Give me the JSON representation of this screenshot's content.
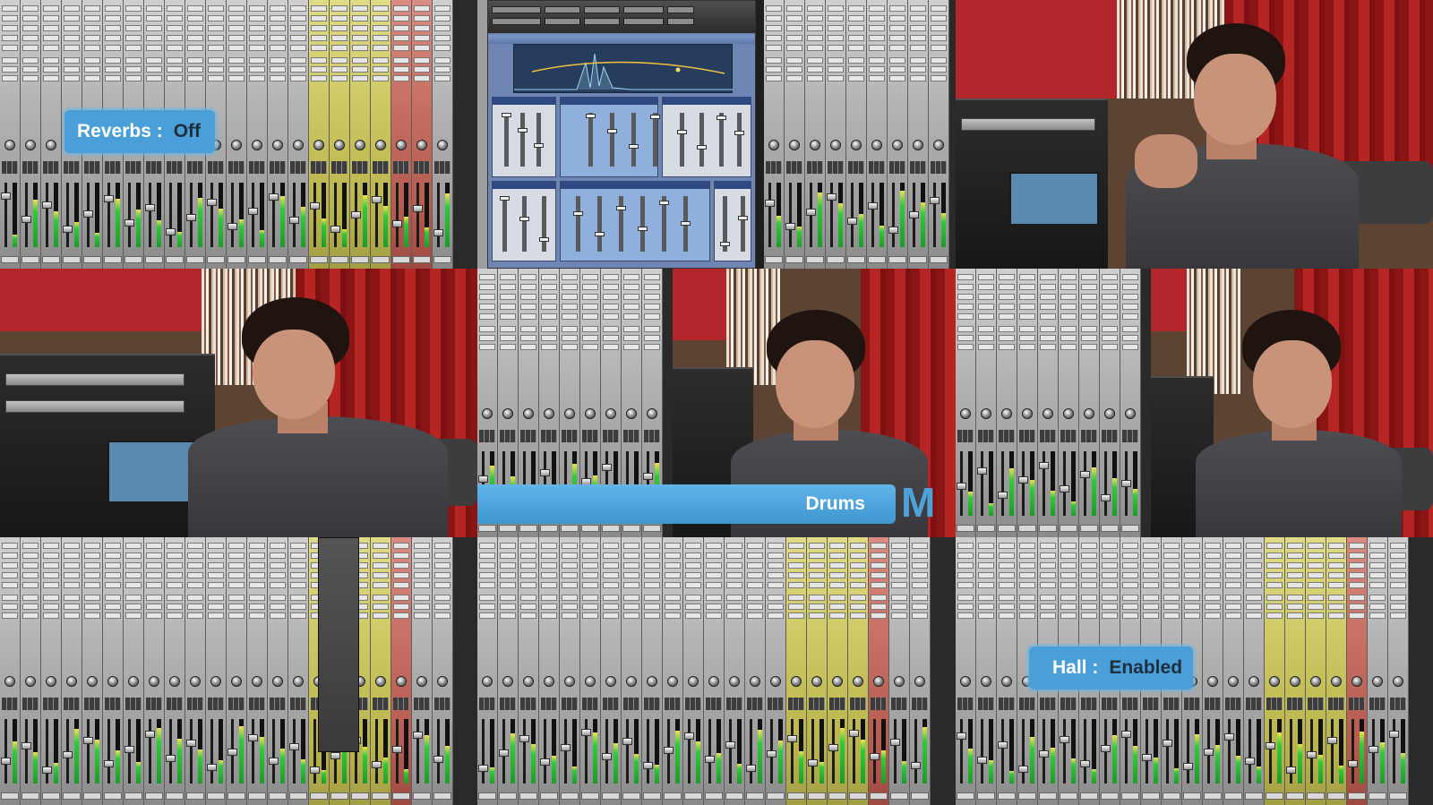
{
  "overlays": {
    "reverbs": {
      "label": "Reverbs :",
      "value": "Off"
    },
    "lower_third": {
      "title": "Drums"
    },
    "logo": {
      "glyph": "M"
    },
    "hall": {
      "label": "Hall :",
      "value": "Enabled"
    }
  },
  "colors": {
    "badge": "#4a9fd8",
    "badge_value_text": "#1e2f3f",
    "aux_strip": "#cdc763",
    "master_strip": "#c66e62",
    "curtain": "#b52523"
  },
  "tiles": [
    "mixer-with-reverb-plugin",
    "mixer-with-reverb-plugin",
    "presenter-video",
    "presenter-video",
    "mixer-and-presenter-video",
    "mixer-and-presenter-video",
    "mixer-with-open-strip",
    "mixer",
    "mixer"
  ]
}
